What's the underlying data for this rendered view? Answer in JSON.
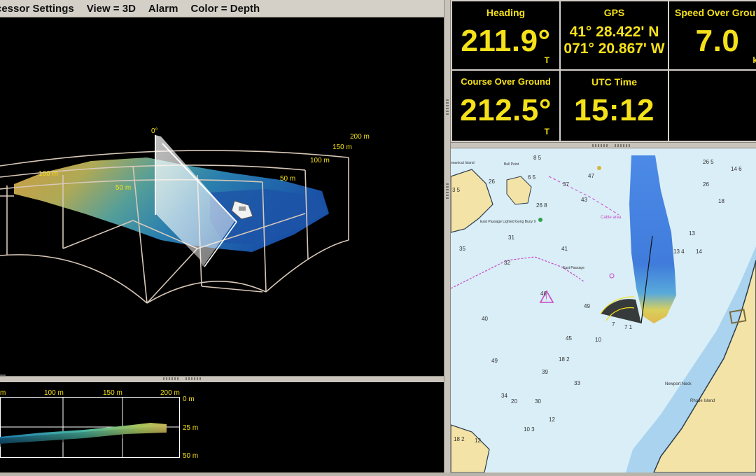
{
  "menu": {
    "processor_settings": "cessor Settings",
    "view": "View = 3D",
    "alarm": "Alarm",
    "color": "Color = Depth"
  },
  "view3d": {
    "labels": {
      "angle": "0°",
      "r200": "200 m",
      "r150": "150 m",
      "r100_right": "100 m",
      "r50_right": "50 m",
      "r100_left": "100 m",
      "r50_left": "50 m"
    }
  },
  "profile": {
    "x_labels": [
      "m",
      "100 m",
      "150 m",
      "200 m"
    ],
    "y_labels": [
      "0 m",
      "25 m",
      "50 m"
    ]
  },
  "instruments": {
    "heading": {
      "label": "Heading",
      "value": "211.9°",
      "unit": "T"
    },
    "gps": {
      "label": "GPS",
      "lat": "41° 28.422' N",
      "lon": "071° 20.867' W"
    },
    "sog": {
      "label": "Speed Over Ground",
      "value": "7.0",
      "unit": "k"
    },
    "cog": {
      "label": "Course Over Ground",
      "value": "212.5°",
      "unit": "T"
    },
    "utc": {
      "label": "UTC Time",
      "value": "15:12"
    }
  },
  "chart": {
    "place_labels": {
      "conanicut": "onanicut Island",
      "bull_point": "Bull Point",
      "gong_buoy": "East Passage Lighted Gong Buoy 9",
      "east_passage": "East Passage",
      "cable_area": "Cable area",
      "newport_neck": "Newport Neck",
      "rhode_island": "Rhode Island"
    },
    "soundings": [
      {
        "t": "37"
      },
      {
        "t": "47"
      },
      {
        "t": "43"
      },
      {
        "t": "31"
      },
      {
        "t": "35"
      },
      {
        "t": "32"
      },
      {
        "t": "41"
      },
      {
        "t": "40"
      },
      {
        "t": "45"
      },
      {
        "t": "49"
      },
      {
        "t": "49"
      },
      {
        "t": "46"
      },
      {
        "t": "39"
      },
      {
        "t": "34"
      },
      {
        "t": "30"
      },
      {
        "t": "33"
      },
      {
        "t": "26"
      },
      {
        "t": "18"
      },
      {
        "t": "14"
      },
      {
        "t": "10"
      },
      {
        "t": "13"
      },
      {
        "t": "26"
      },
      {
        "t": "20"
      },
      {
        "t": "26 8"
      },
      {
        "t": "7"
      },
      {
        "t": "18 2"
      },
      {
        "t": "14 6"
      },
      {
        "t": "26 5"
      },
      {
        "t": "10 3"
      },
      {
        "t": "12"
      },
      {
        "t": "12"
      },
      {
        "t": "18 2"
      },
      {
        "t": "3 5"
      },
      {
        "t": "8 5"
      },
      {
        "t": "7 1"
      },
      {
        "t": "6 5"
      },
      {
        "t": "13 4"
      }
    ]
  },
  "colors": {
    "instrument_text": "#f5e11a",
    "water": "#d9eef7",
    "shallow": "#a9d3ef",
    "land": "#f3e3a6",
    "depth_contour": "#c847c8"
  }
}
